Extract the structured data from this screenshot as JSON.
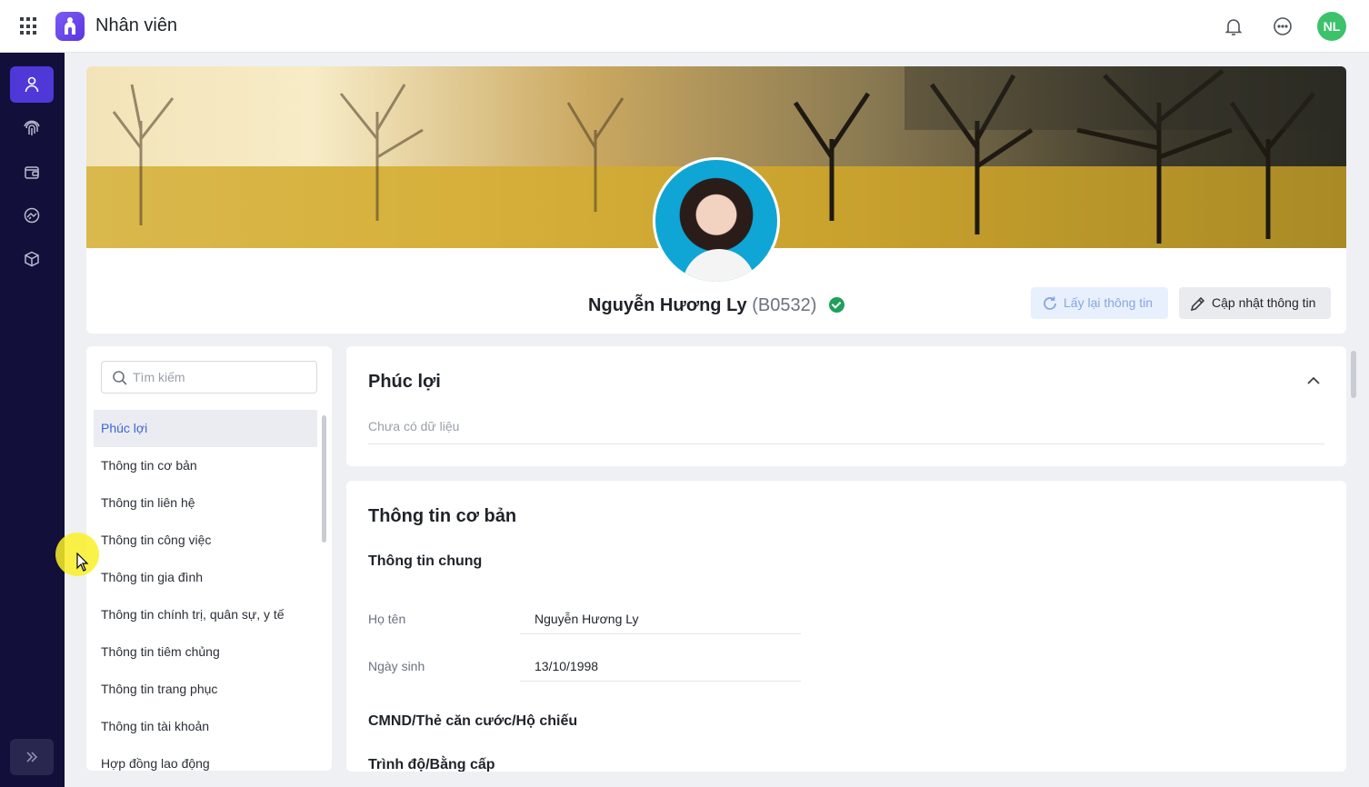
{
  "header": {
    "app_title": "Nhân viên",
    "user_initials": "NL",
    "icons": [
      "apps-grid-icon",
      "app-logo-icon",
      "bell-icon",
      "more-icon"
    ]
  },
  "rail": {
    "items": [
      "person-icon",
      "fingerprint-icon",
      "wallet-icon",
      "handshake-icon",
      "box-icon"
    ],
    "expand_icon": "chevron-double-right-icon",
    "active_color": "#4f38d8",
    "bg_color": "#120f3a"
  },
  "profile": {
    "name": "Nguyễn Hương Ly",
    "code": "(B0532)",
    "refresh_label": "Lấy lại thông tin",
    "update_label": "Cập nhật thông tin"
  },
  "sidenav": {
    "search_placeholder": "Tìm kiếm",
    "items": [
      "Phúc lợi",
      "Thông tin cơ bản",
      "Thông tin liên hệ",
      "Thông tin công việc",
      "Thông tin gia đình",
      "Thông tin chính trị, quân sự, y tế",
      "Thông tin tiêm chủng",
      "Thông tin trang phục",
      "Thông tin tài khoản",
      "Hợp đồng lao động"
    ]
  },
  "benefits": {
    "title": "Phúc lợi",
    "empty": "Chưa có dữ liệu"
  },
  "basic_info": {
    "title": "Thông tin cơ bản",
    "general_title": "Thông tin chung",
    "fields": [
      {
        "label": "Họ tên",
        "value": "Nguyễn Hương Ly"
      },
      {
        "label": "Ngày sinh",
        "value": "13/10/1998"
      }
    ],
    "id_title": "CMND/Thẻ căn cước/Hộ chiếu",
    "degree_title": "Trình độ/Bằng cấp"
  }
}
